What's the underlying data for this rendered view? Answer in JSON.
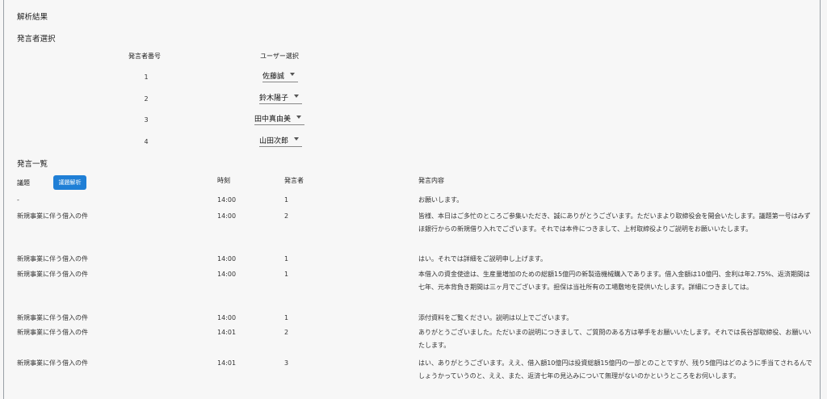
{
  "title": "解析結果",
  "speaker_section": {
    "title": "発言者選択",
    "col_number": "発言者番号",
    "col_user": "ユーザー選択",
    "rows": [
      {
        "number": "1",
        "user": "佐藤誠"
      },
      {
        "number": "2",
        "user": "鈴木陽子"
      },
      {
        "number": "3",
        "user": "田中真由美"
      },
      {
        "number": "4",
        "user": "山田次郎"
      }
    ]
  },
  "list_section": {
    "title": "発言一覧",
    "col_topic": "議題",
    "topic_button": "議題解析",
    "col_time": "時刻",
    "col_speaker": "発言者",
    "col_content": "発言内容",
    "rows": [
      {
        "topic": "-",
        "time": "14:00",
        "speaker": "1",
        "content": "お願いします。"
      },
      {
        "topic": "新規事業に伴う借入の件",
        "time": "14:00",
        "speaker": "2",
        "content": "皆様、本日はご多忙のところご参集いただき、誠にありがとうございます。ただいまより取締役会を開会いたします。議題第一号はみずほ銀行からの新規借り入れでございます。それでは本件につきまして、上村取締役よりご説明をお願いいたします。"
      },
      {
        "topic": "新規事業に伴う借入の件",
        "time": "14:00",
        "speaker": "1",
        "content": "はい。それでは詳細をご説明申し上げます。"
      },
      {
        "topic": "新規事業に伴う借入の件",
        "time": "14:00",
        "speaker": "1",
        "content": "本借入の資金使途は、生産量増加のための総額15億円の新製造機械購入であります。借入金額は10億円、金利は年2.75%、返済期間は七年、元本背負き期間は三ヶ月でございます。担保は当社所有の工場敷地を提供いたします。詳細につきましては。"
      },
      {
        "topic": "新規事業に伴う借入の件",
        "time": "14:00",
        "speaker": "1",
        "content": "添付資料をご覧ください。説明は以上でございます。"
      },
      {
        "topic": "新規事業に伴う借入の件",
        "time": "14:01",
        "speaker": "2",
        "content": "ありがとうございました。ただいまの説明につきまして、ご質問のある方は挙手をお願いいたします。それでは長谷部取締役、お願いいたします。"
      },
      {
        "topic": "新規事業に伴う借入の件",
        "time": "14:01",
        "speaker": "3",
        "content": "はい、ありがとうございます。ええ、借入額10億円は投資総額15億円の一部とのことですが、残り5億円はどのように手当てされるんでしょうかっていうのと、ええ、また、返済七年の見込みについて無理がないのかというところをお伺いします。"
      }
    ]
  }
}
